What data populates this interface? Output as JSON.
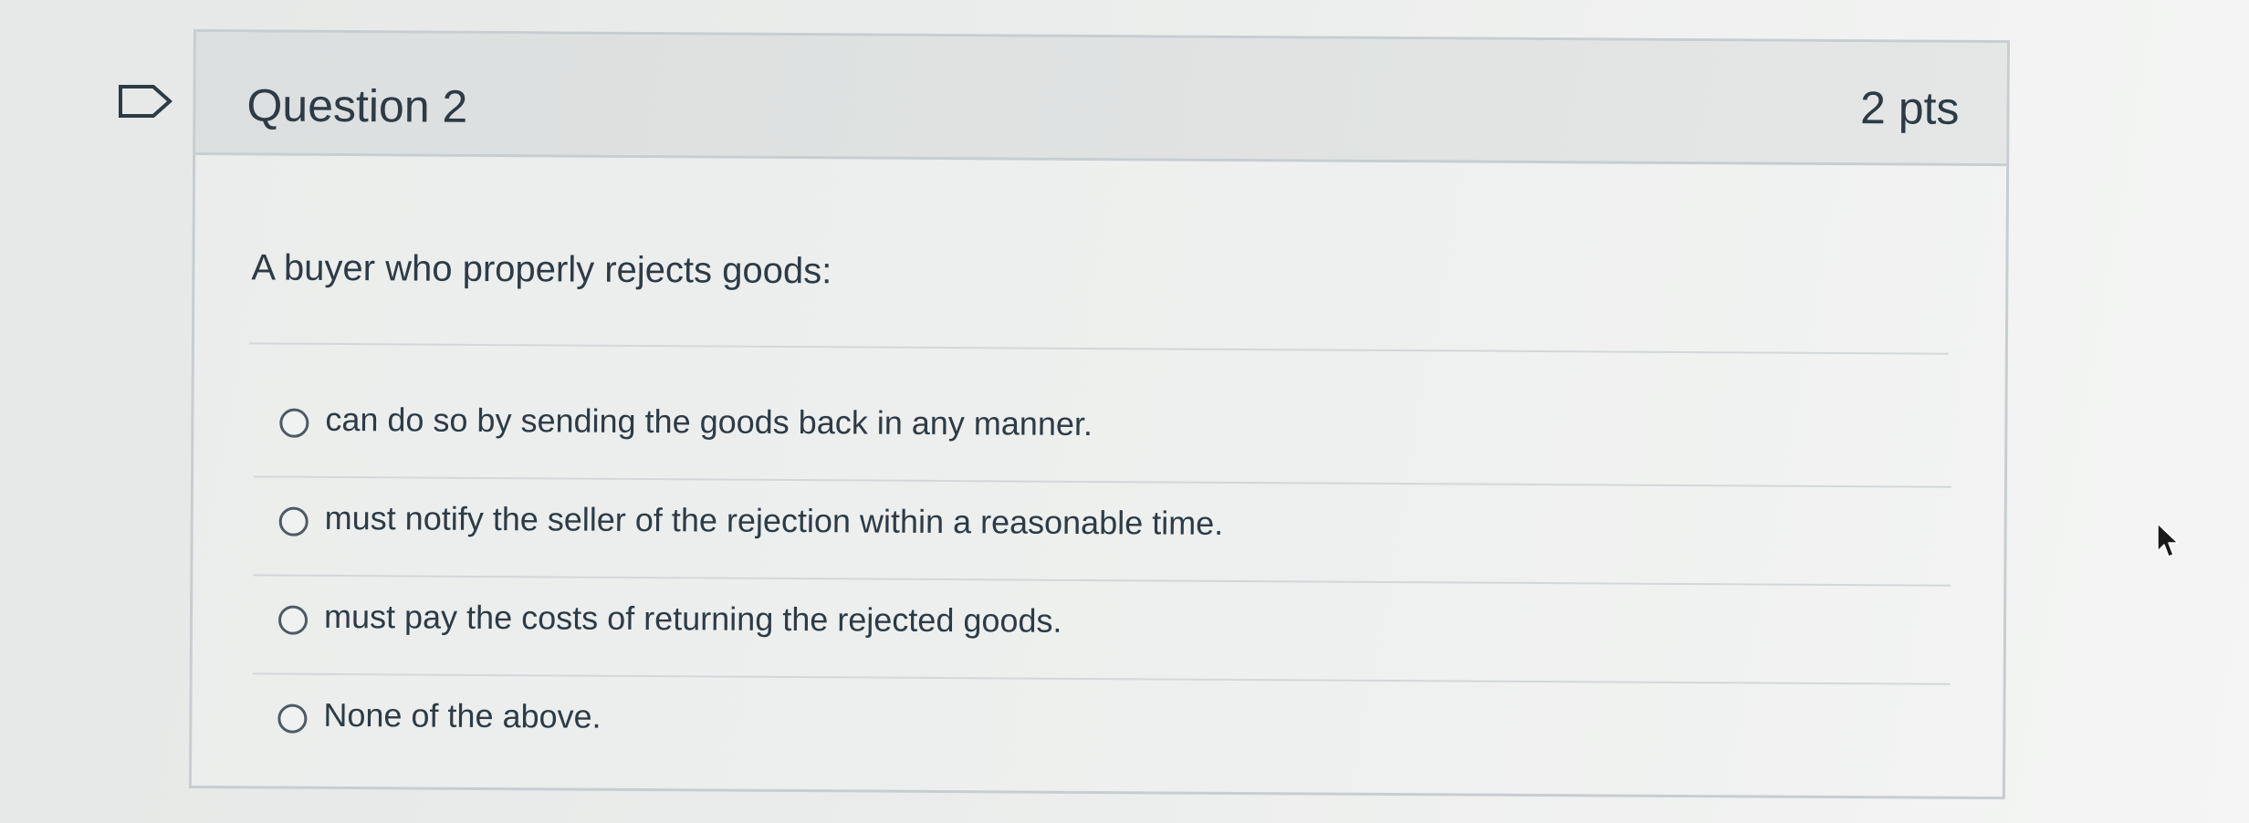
{
  "question": {
    "title": "Question 2",
    "points": "2 pts",
    "text": "A buyer who properly rejects goods:",
    "flag_icon": "flag-outline-icon"
  },
  "answers": [
    {
      "label": "can do so by sending the goods back in any manner.",
      "selected": false
    },
    {
      "label": "must notify the seller of the rejection within a reasonable time.",
      "selected": false
    },
    {
      "label": "must pay the costs of returning the rejected goods.",
      "selected": false
    },
    {
      "label": "None of the above.",
      "selected": false
    }
  ],
  "colors": {
    "text": "#2d3b45",
    "border": "#c7cdd1",
    "header_bg": "#dcdfdf"
  }
}
